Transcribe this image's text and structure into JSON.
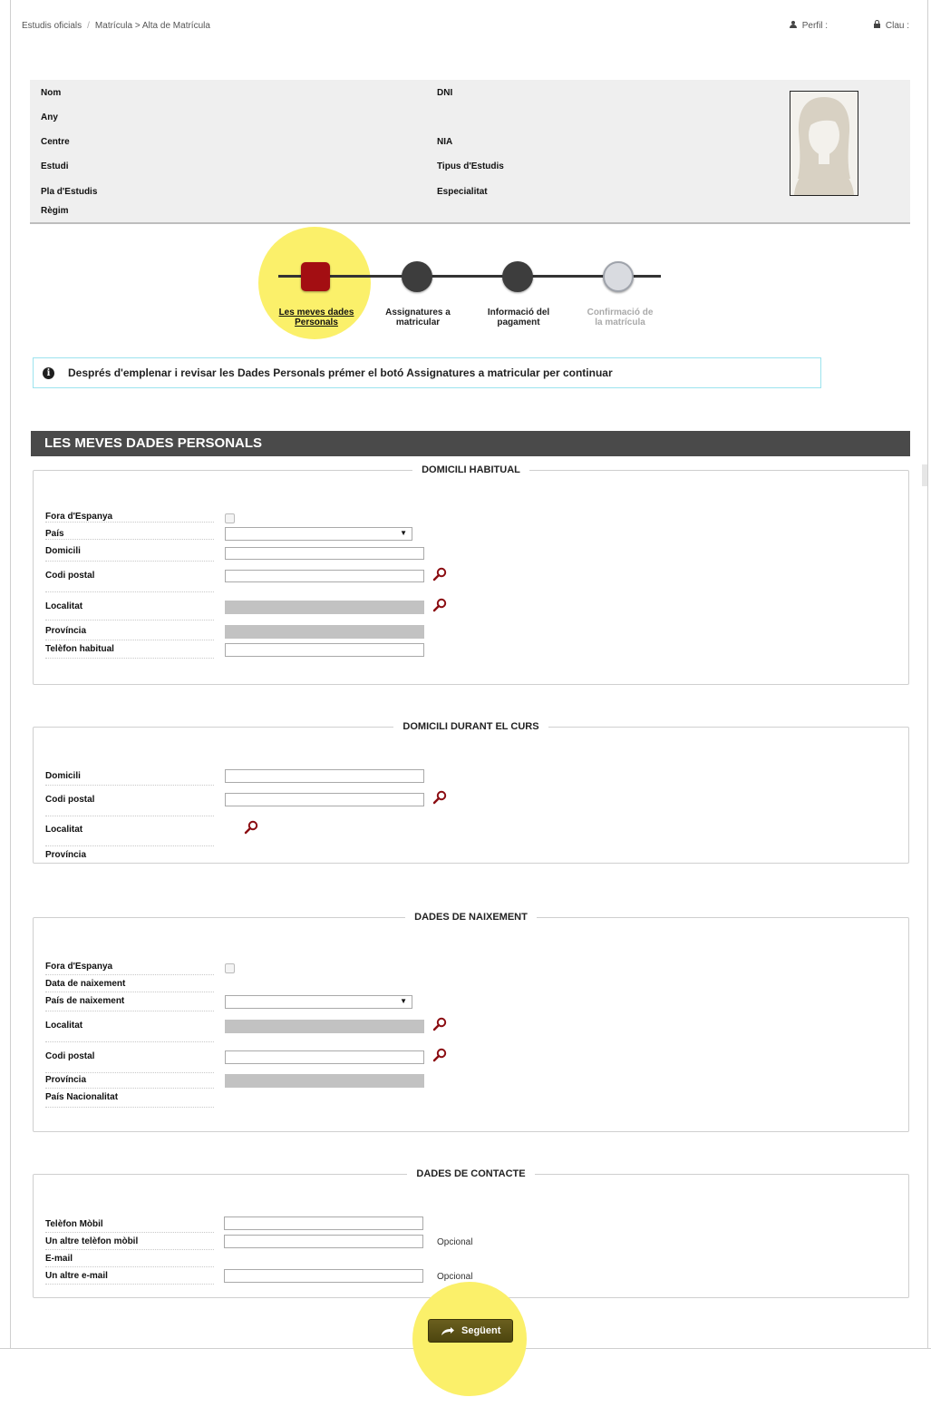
{
  "breadcrumb": {
    "home": "Estudis oficials",
    "current": "Matrícula > Alta de Matrícula"
  },
  "toolbar": {
    "profile_label": "Perfil :",
    "key_label": "Clau :"
  },
  "student_info": {
    "nom": "Nom",
    "any": "Any",
    "centre": "Centre",
    "estudi": "Estudi",
    "pla": "Pla d'Estudis",
    "regim": "Règim",
    "dni": "DNI",
    "nia": "NIA",
    "tipus": "Tipus d'Estudis",
    "especialitat": "Especialitat"
  },
  "steps": [
    {
      "line1": "Les meves dades",
      "line2": "Personals",
      "state": "active"
    },
    {
      "line1": "Assignatures a",
      "line2": "matricular",
      "state": "pending"
    },
    {
      "line1": "Informació del",
      "line2": "pagament",
      "state": "pending"
    },
    {
      "line1": "Confirmació de",
      "line2": "la matrícula",
      "state": "disabled"
    }
  ],
  "notice": "Després d'emplenar i revisar les Dades Personals prémer el botó Assignatures a matricular per continuar",
  "section_title": "LES MEVES DADES PERSONALS",
  "domicili_habitual": {
    "legend": "DOMICILI HABITUAL",
    "fora": "Fora d'Espanya",
    "pais": "País",
    "domicili": "Domicili",
    "codi_postal": "Codi postal",
    "localitat": "Localitat",
    "provincia": "Província",
    "telefon": "Telèfon habitual"
  },
  "domicili_curs": {
    "legend": "DOMICILI DURANT EL CURS",
    "domicili": "Domicili",
    "codi_postal": "Codi postal",
    "localitat": "Localitat",
    "provincia": "Província"
  },
  "naixement": {
    "legend": "DADES DE NAIXEMENT",
    "fora": "Fora d'Espanya",
    "data": "Data de naixement",
    "pais": "País de naixement",
    "localitat": "Localitat",
    "codi_postal": "Codi postal",
    "provincia": "Província",
    "nacionalitat": "País Nacionalitat"
  },
  "contacte": {
    "legend": "DADES DE CONTACTE",
    "mobil": "Telèfon Mòbil",
    "altre_mobil": "Un altre telèfon mòbil",
    "email": "E-mail",
    "altre_email": "Un altre e-mail",
    "optional": "Opcional"
  },
  "buttons": {
    "next": "Següent"
  },
  "colors": {
    "active_step": "#a30e12",
    "highlight": "#fbf06a",
    "header_bar": "#4a4a4a",
    "search_icon": "#8b0d12"
  }
}
